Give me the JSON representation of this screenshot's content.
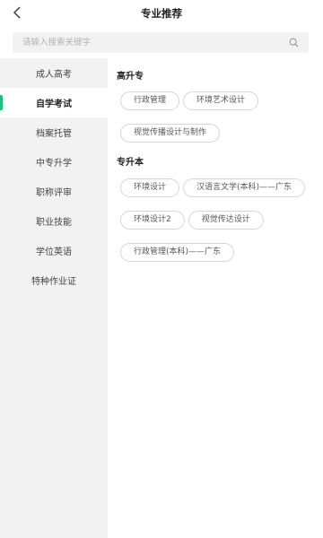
{
  "header": {
    "title": "专业推荐",
    "back_icon": "chevron-left-icon"
  },
  "search": {
    "placeholder": "请输入搜索关键字",
    "icon": "search-icon"
  },
  "sidebar": {
    "active_color": "#1fbf7a",
    "items": [
      {
        "label": "成人高考",
        "active": false
      },
      {
        "label": "自学考试",
        "active": true
      },
      {
        "label": "档案托管",
        "active": false
      },
      {
        "label": "中专升学",
        "active": false
      },
      {
        "label": "职称评审",
        "active": false
      },
      {
        "label": "职业技能",
        "active": false
      },
      {
        "label": "学位英语",
        "active": false
      },
      {
        "label": "特种作业证",
        "active": false
      }
    ]
  },
  "sections": [
    {
      "title": "高升专",
      "tags": [
        "行政管理",
        "环境艺术设计",
        "视觉传播设计与制作"
      ]
    },
    {
      "title": "专升本",
      "tags": [
        "环境设计",
        "汉语言文学(本科)——广东",
        "环境设计2",
        "视觉传达设计",
        "行政管理(本科)——广东"
      ]
    }
  ]
}
